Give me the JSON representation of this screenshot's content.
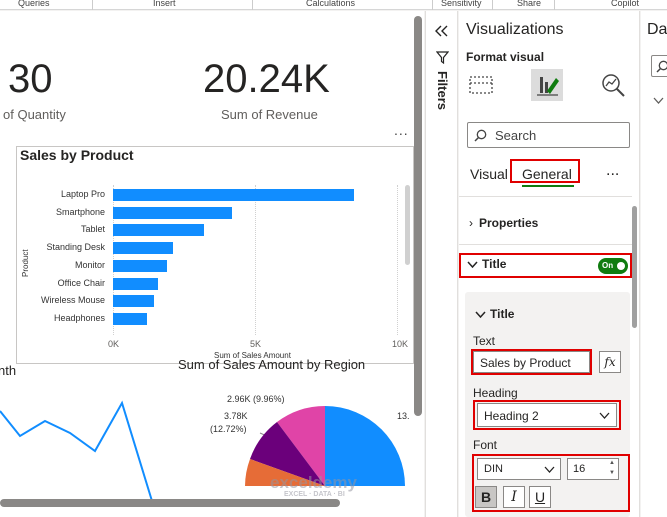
{
  "ribbon": {
    "groups": [
      "Queries",
      "Insert",
      "Calculations",
      "Sensitivity",
      "Share",
      "Copilot"
    ]
  },
  "cards": {
    "quantity": {
      "value": "30",
      "label": "of Quantity"
    },
    "revenue": {
      "value": "20.24K",
      "label": "Sum of Revenue"
    }
  },
  "bar_chart": {
    "more_label": "...",
    "y_axis_label": "Product",
    "x_axis_label": "Sum of Sales Amount"
  },
  "region_chart": {
    "title": "Sum of Sales Amount by Region",
    "labels": {
      "a": "2.96K (9.96%)",
      "b1": "3.78K",
      "b2": "(12.72%)",
      "c": "13."
    }
  },
  "line_chart": {
    "partial_title": "nth"
  },
  "chart_data": [
    {
      "type": "bar",
      "title": "Sales by Product",
      "categories": [
        "Laptop Pro",
        "Smartphone",
        "Tablet",
        "Standing Desk",
        "Monitor",
        "Office Chair",
        "Wireless Mouse",
        "Headphones"
      ],
      "values": [
        8500,
        4200,
        3200,
        2100,
        1900,
        1600,
        1450,
        1200
      ],
      "xlabel": "Sum of Sales Amount",
      "ylabel": "Product",
      "xlim": [
        0,
        10000
      ],
      "xticks": [
        "0K",
        "5K",
        "10K"
      ],
      "grid": true
    },
    {
      "type": "pie",
      "title": "Sum of Sales Amount by Region",
      "slices": [
        {
          "value": 2960,
          "label": "2.96K (9.96%)",
          "color": "#e044a7"
        },
        {
          "value": 3780,
          "label": "3.78K (12.72%)",
          "color": "#6b007b"
        }
      ]
    }
  ],
  "filters": {
    "label": "Filters",
    "collapse_icon": "double-chevron-left"
  },
  "viz_pane": {
    "title": "Visualizations",
    "format_label": "Format visual",
    "search_placeholder": "Search",
    "tabs": {
      "visual": "Visual",
      "general": "General",
      "more": "..."
    },
    "sections": {
      "properties": "Properties",
      "title": "Title"
    },
    "toggle_label": "On",
    "title_card": {
      "header": "Title",
      "text_label": "Text",
      "text_value": "Sales by Product",
      "fx_label": "fx",
      "heading_label": "Heading",
      "heading_value": "Heading 2",
      "font_label": "Font",
      "font_family": "DIN",
      "font_size": "16",
      "bold": "B",
      "italic": "I",
      "underline": "U"
    }
  },
  "data_pane": {
    "title": "Data"
  },
  "watermark": {
    "brand": "exceldemy",
    "tagline": "EXCEL · DATA · BI"
  },
  "colors": {
    "accent": "#118dff",
    "toggle_on": "#107c10",
    "highlight": "#e00000"
  }
}
